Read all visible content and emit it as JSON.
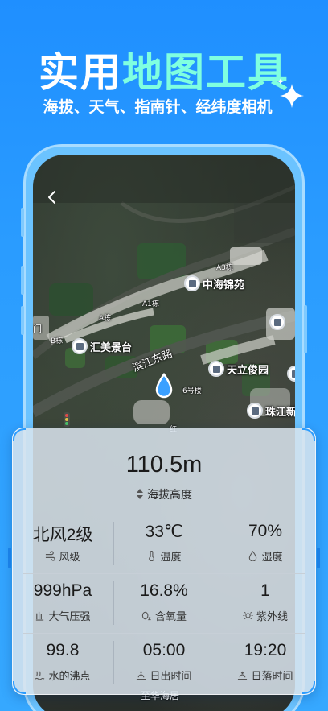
{
  "header": {
    "title_white": "实用",
    "title_green": "地图工具",
    "subtitle": "海拔、天气、指南针、经纬度相机"
  },
  "map": {
    "pois": [
      {
        "name": "中海锦苑"
      },
      {
        "name": "汇美景台"
      },
      {
        "name": "天立俊园"
      },
      {
        "name": "珠江新"
      }
    ],
    "building_labels": [
      "A3栋",
      "A1栋",
      "A栋",
      "B栋",
      "6号楼",
      "门",
      "红"
    ],
    "road": "滨江东路",
    "bottom_label": "至华海居"
  },
  "altitude": {
    "value": "110.5m",
    "label": "海拔高度"
  },
  "metrics": [
    {
      "value": "北风2级",
      "label": "风级",
      "icon": "wind-icon"
    },
    {
      "value": "33℃",
      "label": "温度",
      "icon": "thermometer-icon"
    },
    {
      "value": "70%",
      "label": "湿度",
      "icon": "humidity-icon"
    },
    {
      "value": "999hPa",
      "label": "大气压强",
      "icon": "pressure-icon"
    },
    {
      "value": "16.8%",
      "label": "含氧量",
      "icon": "oxygen-icon"
    },
    {
      "value": "1",
      "label": "紫外线",
      "icon": "sun-icon"
    },
    {
      "value": "99.8",
      "label": "水的沸点",
      "icon": "boiling-icon"
    },
    {
      "value": "05:00",
      "label": "日出时间",
      "icon": "sunrise-icon"
    },
    {
      "value": "19:20",
      "label": "日落时间",
      "icon": "sunset-icon"
    }
  ],
  "colors": {
    "background": "#2a9cff",
    "title_accent": "#7fffe0",
    "location_marker": "#3aa0ff"
  }
}
